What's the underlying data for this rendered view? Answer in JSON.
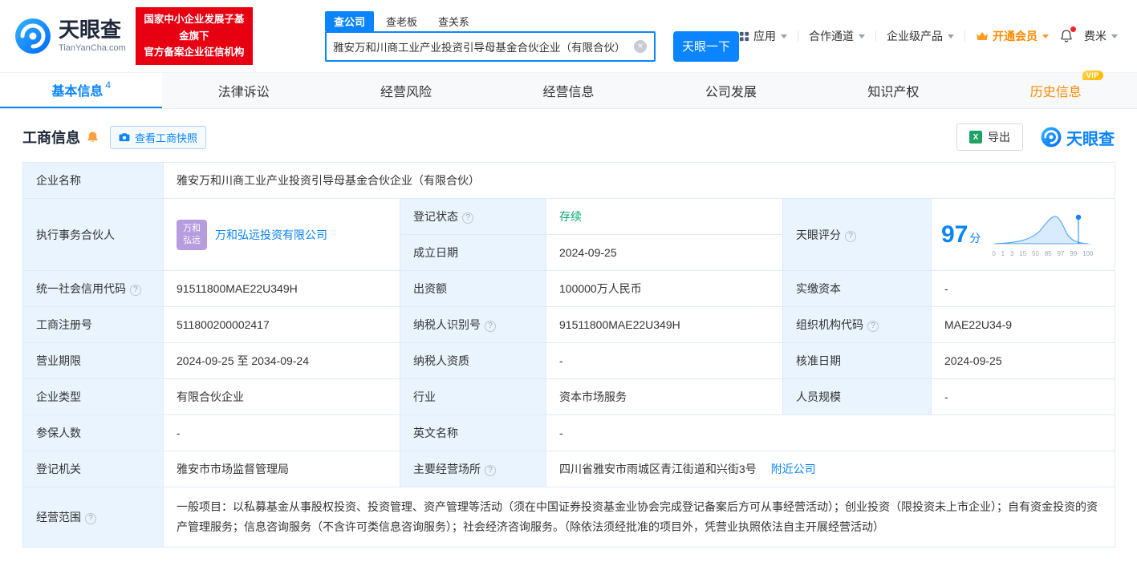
{
  "colors": {
    "brand_blue": "#0a84ff",
    "badge_red": "#e60012",
    "status_green": "#00a870",
    "vip_orange": "#ff8a00",
    "excel_green": "#21a366",
    "avatar_purple": "#b79ce0"
  },
  "icons": {
    "info": "?",
    "clear": "×",
    "excel": "X"
  },
  "header": {
    "logo_title": "天眼查",
    "logo_domain": "TianYanCha.com",
    "badge_line1": "国家中小企业发展子基金旗下",
    "badge_line2": "官方备案企业征信机构",
    "search_tabs": [
      {
        "label": "查公司"
      },
      {
        "label": "查老板"
      },
      {
        "label": "查关系"
      }
    ],
    "search_value": "雅安万和川商工业产业投资引导母基金合伙企业（有限合伙）",
    "search_button": "天眼一下",
    "nav_app": "应用",
    "nav_partner": "合作通道",
    "nav_enterprise": "企业级产品",
    "nav_vip": "开通会员",
    "nav_user": "费米"
  },
  "tabs": {
    "basic": "基本信息",
    "basic_count": "4",
    "legal": "法律诉讼",
    "risk": "经营风险",
    "operation": "经营信息",
    "development": "公司发展",
    "ip": "知识产权",
    "history": "历史信息",
    "history_vip": "VIP"
  },
  "section": {
    "title": "工商信息",
    "snapshot_button": "查看工商快照",
    "export_button": "导出",
    "watermark": "天眼查"
  },
  "fields": {
    "company_name": {
      "label": "企业名称",
      "value": "雅安万和川商工业产业投资引导母基金合伙企业（有限合伙）"
    },
    "partner": {
      "label": "执行事务合伙人",
      "avatar_line1": "万和",
      "avatar_line2": "弘远",
      "company": "万和弘远投资有限公司"
    },
    "reg_status": {
      "label": "登记状态",
      "value": "存续"
    },
    "establish_date": {
      "label": "成立日期",
      "value": "2024-09-25"
    },
    "score": {
      "label": "天眼评分",
      "value": "97",
      "unit": "分"
    },
    "credit_code": {
      "label": "统一社会信用代码",
      "value": "91511800MAE22U349H"
    },
    "capital": {
      "label": "出资额",
      "value": "100000万人民币"
    },
    "paid_capital": {
      "label": "实缴资本",
      "value": "-"
    },
    "reg_number": {
      "label": "工商注册号",
      "value": "511800200002417"
    },
    "taxpayer_id": {
      "label": "纳税人识别号",
      "value": "91511800MAE22U349H"
    },
    "org_code": {
      "label": "组织机构代码",
      "value": "MAE22U34-9"
    },
    "business_term": {
      "label": "营业期限",
      "value": "2024-09-25 至 2034-09-24"
    },
    "taxpayer_quality": {
      "label": "纳税人资质",
      "value": "-"
    },
    "approval_date": {
      "label": "核准日期",
      "value": "2024-09-25"
    },
    "company_type": {
      "label": "企业类型",
      "value": "有限合伙企业"
    },
    "industry": {
      "label": "行业",
      "value": "资本市场服务"
    },
    "staff_size": {
      "label": "人员规模",
      "value": "-"
    },
    "insured_count": {
      "label": "参保人数",
      "value": "-"
    },
    "english_name": {
      "label": "英文名称",
      "value": "-"
    },
    "reg_authority": {
      "label": "登记机关",
      "value": "雅安市市场监督管理局"
    },
    "address": {
      "label": "主要经营场所",
      "value": "四川省雅安市雨城区青江街道和兴街3号",
      "nearby": "附近公司"
    },
    "scope": {
      "label": "经营范围",
      "value": "一般项目：以私募基金从事股权投资、投资管理、资产管理等活动（须在中国证券投资基金业协会完成登记备案后方可从事经营活动）；创业投资（限投资未上市企业）；自有资金投资的资产管理服务；信息咨询服务（不含许可类信息咨询服务）；社会经济咨询服务。（除依法须经批准的项目外，凭营业执照依法自主开展经营活动）"
    }
  },
  "score_chart": {
    "axis": [
      "0",
      "1",
      "3",
      "15",
      "50",
      "85",
      "97",
      "99",
      "100"
    ]
  }
}
